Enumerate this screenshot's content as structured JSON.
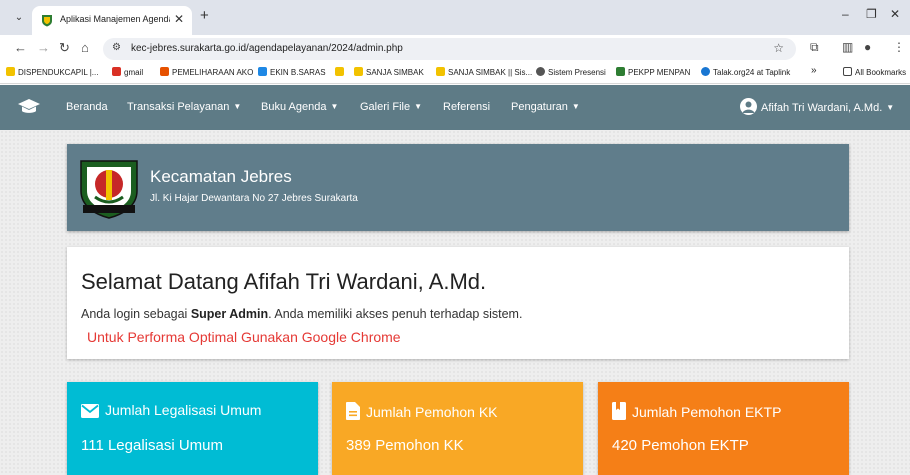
{
  "browser": {
    "tab_title": "Aplikasi Manajemen Agenda Pe",
    "url": "kec-jebres.surakarta.go.id/agendapelayanan/2024/admin.php"
  },
  "bookmarks": [
    {
      "label": "DISPENDUKCAPIL |...",
      "color": "#f2c200"
    },
    {
      "label": "gmail",
      "color": "#d93025"
    },
    {
      "label": "PEMELIHARAAN AKO",
      "color": "#e65100"
    },
    {
      "label": "EKIN B.SARAS",
      "color": "#1e88e5"
    },
    {
      "label": "",
      "color": "#f2c200"
    },
    {
      "label": "SANJA SIMBAK",
      "color": "#f2c200"
    },
    {
      "label": "SANJA SIMBAK || Sis...",
      "color": "#f2c200"
    },
    {
      "label": "Sistem Presensi",
      "color": "#555555"
    },
    {
      "label": "PEKPP MENPAN",
      "color": "#2e7d32"
    },
    {
      "label": "Talak.org24 at Taplink",
      "color": "#1976d2"
    }
  ],
  "bookmarks_overflow": "»",
  "all_bookmarks": "All Bookmarks",
  "nav": {
    "items": [
      {
        "label": "Beranda",
        "dropdown": false
      },
      {
        "label": "Transaksi Pelayanan",
        "dropdown": true
      },
      {
        "label": "Buku Agenda",
        "dropdown": true
      },
      {
        "label": "Galeri File",
        "dropdown": true
      },
      {
        "label": "Referensi",
        "dropdown": false
      },
      {
        "label": "Pengaturan",
        "dropdown": true
      }
    ],
    "user": "Afifah Tri Wardani, A.Md."
  },
  "header": {
    "org_name": "Kecamatan Jebres",
    "address": "Jl. Ki Hajar Dewantara No 27 Jebres Surakarta"
  },
  "welcome": {
    "title": "Selamat Datang Afifah Tri Wardani, A.Md.",
    "info_prefix": "Anda login sebagai ",
    "role": "Super Admin",
    "info_suffix": ". Anda memiliki akses penuh terhadap sistem.",
    "chrome_note": "Untuk Performa Optimal Gunakan Google Chrome"
  },
  "stats": [
    {
      "title": "Jumlah Legalisasi Umum",
      "value": "111 Legalisasi Umum",
      "color": "#00bcd4",
      "icon": "envelope-icon"
    },
    {
      "title": "Jumlah Pemohon KK",
      "value": "389 Pemohon KK",
      "color": "#f9a825",
      "icon": "document-icon"
    },
    {
      "title": "Jumlah Pemohon EKTP",
      "value": "420 Pemohon EKTP",
      "color": "#f57f17",
      "icon": "book-icon"
    }
  ]
}
